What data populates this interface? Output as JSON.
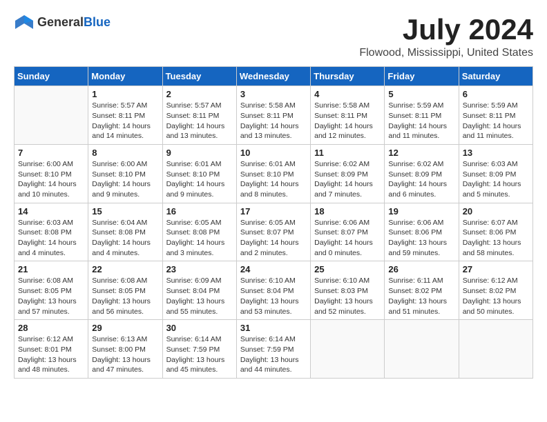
{
  "header": {
    "logo": {
      "text_general": "General",
      "text_blue": "Blue",
      "icon_shape": "flag"
    },
    "title": "July 2024",
    "location": "Flowood, Mississippi, United States"
  },
  "days_of_week": [
    "Sunday",
    "Monday",
    "Tuesday",
    "Wednesday",
    "Thursday",
    "Friday",
    "Saturday"
  ],
  "weeks": [
    [
      {
        "day": "",
        "sunrise": "",
        "sunset": "",
        "daylight": ""
      },
      {
        "day": "1",
        "sunrise": "Sunrise: 5:57 AM",
        "sunset": "Sunset: 8:11 PM",
        "daylight": "Daylight: 14 hours and 14 minutes."
      },
      {
        "day": "2",
        "sunrise": "Sunrise: 5:57 AM",
        "sunset": "Sunset: 8:11 PM",
        "daylight": "Daylight: 14 hours and 13 minutes."
      },
      {
        "day": "3",
        "sunrise": "Sunrise: 5:58 AM",
        "sunset": "Sunset: 8:11 PM",
        "daylight": "Daylight: 14 hours and 13 minutes."
      },
      {
        "day": "4",
        "sunrise": "Sunrise: 5:58 AM",
        "sunset": "Sunset: 8:11 PM",
        "daylight": "Daylight: 14 hours and 12 minutes."
      },
      {
        "day": "5",
        "sunrise": "Sunrise: 5:59 AM",
        "sunset": "Sunset: 8:11 PM",
        "daylight": "Daylight: 14 hours and 11 minutes."
      },
      {
        "day": "6",
        "sunrise": "Sunrise: 5:59 AM",
        "sunset": "Sunset: 8:11 PM",
        "daylight": "Daylight: 14 hours and 11 minutes."
      }
    ],
    [
      {
        "day": "7",
        "sunrise": "Sunrise: 6:00 AM",
        "sunset": "Sunset: 8:10 PM",
        "daylight": "Daylight: 14 hours and 10 minutes."
      },
      {
        "day": "8",
        "sunrise": "Sunrise: 6:00 AM",
        "sunset": "Sunset: 8:10 PM",
        "daylight": "Daylight: 14 hours and 9 minutes."
      },
      {
        "day": "9",
        "sunrise": "Sunrise: 6:01 AM",
        "sunset": "Sunset: 8:10 PM",
        "daylight": "Daylight: 14 hours and 9 minutes."
      },
      {
        "day": "10",
        "sunrise": "Sunrise: 6:01 AM",
        "sunset": "Sunset: 8:10 PM",
        "daylight": "Daylight: 14 hours and 8 minutes."
      },
      {
        "day": "11",
        "sunrise": "Sunrise: 6:02 AM",
        "sunset": "Sunset: 8:09 PM",
        "daylight": "Daylight: 14 hours and 7 minutes."
      },
      {
        "day": "12",
        "sunrise": "Sunrise: 6:02 AM",
        "sunset": "Sunset: 8:09 PM",
        "daylight": "Daylight: 14 hours and 6 minutes."
      },
      {
        "day": "13",
        "sunrise": "Sunrise: 6:03 AM",
        "sunset": "Sunset: 8:09 PM",
        "daylight": "Daylight: 14 hours and 5 minutes."
      }
    ],
    [
      {
        "day": "14",
        "sunrise": "Sunrise: 6:03 AM",
        "sunset": "Sunset: 8:08 PM",
        "daylight": "Daylight: 14 hours and 4 minutes."
      },
      {
        "day": "15",
        "sunrise": "Sunrise: 6:04 AM",
        "sunset": "Sunset: 8:08 PM",
        "daylight": "Daylight: 14 hours and 4 minutes."
      },
      {
        "day": "16",
        "sunrise": "Sunrise: 6:05 AM",
        "sunset": "Sunset: 8:08 PM",
        "daylight": "Daylight: 14 hours and 3 minutes."
      },
      {
        "day": "17",
        "sunrise": "Sunrise: 6:05 AM",
        "sunset": "Sunset: 8:07 PM",
        "daylight": "Daylight: 14 hours and 2 minutes."
      },
      {
        "day": "18",
        "sunrise": "Sunrise: 6:06 AM",
        "sunset": "Sunset: 8:07 PM",
        "daylight": "Daylight: 14 hours and 0 minutes."
      },
      {
        "day": "19",
        "sunrise": "Sunrise: 6:06 AM",
        "sunset": "Sunset: 8:06 PM",
        "daylight": "Daylight: 13 hours and 59 minutes."
      },
      {
        "day": "20",
        "sunrise": "Sunrise: 6:07 AM",
        "sunset": "Sunset: 8:06 PM",
        "daylight": "Daylight: 13 hours and 58 minutes."
      }
    ],
    [
      {
        "day": "21",
        "sunrise": "Sunrise: 6:08 AM",
        "sunset": "Sunset: 8:05 PM",
        "daylight": "Daylight: 13 hours and 57 minutes."
      },
      {
        "day": "22",
        "sunrise": "Sunrise: 6:08 AM",
        "sunset": "Sunset: 8:05 PM",
        "daylight": "Daylight: 13 hours and 56 minutes."
      },
      {
        "day": "23",
        "sunrise": "Sunrise: 6:09 AM",
        "sunset": "Sunset: 8:04 PM",
        "daylight": "Daylight: 13 hours and 55 minutes."
      },
      {
        "day": "24",
        "sunrise": "Sunrise: 6:10 AM",
        "sunset": "Sunset: 8:04 PM",
        "daylight": "Daylight: 13 hours and 53 minutes."
      },
      {
        "day": "25",
        "sunrise": "Sunrise: 6:10 AM",
        "sunset": "Sunset: 8:03 PM",
        "daylight": "Daylight: 13 hours and 52 minutes."
      },
      {
        "day": "26",
        "sunrise": "Sunrise: 6:11 AM",
        "sunset": "Sunset: 8:02 PM",
        "daylight": "Daylight: 13 hours and 51 minutes."
      },
      {
        "day": "27",
        "sunrise": "Sunrise: 6:12 AM",
        "sunset": "Sunset: 8:02 PM",
        "daylight": "Daylight: 13 hours and 50 minutes."
      }
    ],
    [
      {
        "day": "28",
        "sunrise": "Sunrise: 6:12 AM",
        "sunset": "Sunset: 8:01 PM",
        "daylight": "Daylight: 13 hours and 48 minutes."
      },
      {
        "day": "29",
        "sunrise": "Sunrise: 6:13 AM",
        "sunset": "Sunset: 8:00 PM",
        "daylight": "Daylight: 13 hours and 47 minutes."
      },
      {
        "day": "30",
        "sunrise": "Sunrise: 6:14 AM",
        "sunset": "Sunset: 7:59 PM",
        "daylight": "Daylight: 13 hours and 45 minutes."
      },
      {
        "day": "31",
        "sunrise": "Sunrise: 6:14 AM",
        "sunset": "Sunset: 7:59 PM",
        "daylight": "Daylight: 13 hours and 44 minutes."
      },
      {
        "day": "",
        "sunrise": "",
        "sunset": "",
        "daylight": ""
      },
      {
        "day": "",
        "sunrise": "",
        "sunset": "",
        "daylight": ""
      },
      {
        "day": "",
        "sunrise": "",
        "sunset": "",
        "daylight": ""
      }
    ]
  ]
}
